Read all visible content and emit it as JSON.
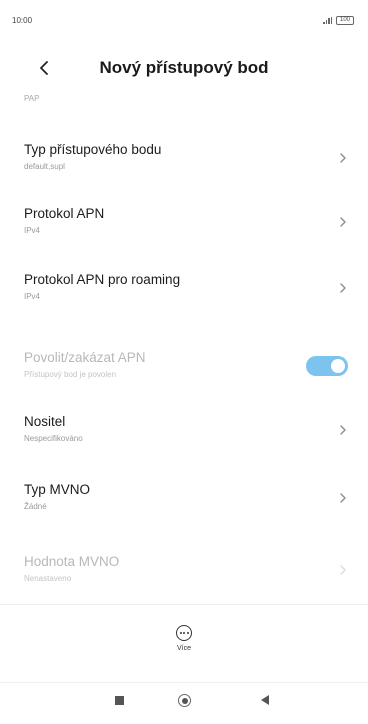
{
  "status_bar": {
    "time": "10:00",
    "battery": "100"
  },
  "header": {
    "title": "Nový přístupový bod"
  },
  "partial_item": {
    "value": "PAP"
  },
  "items": [
    {
      "title": "Typ přístupového bodu",
      "value": "default,supl",
      "control": "chevron",
      "enabled": true
    },
    {
      "title": "Protokol APN",
      "value": "IPv4",
      "control": "chevron",
      "enabled": true
    },
    {
      "title": "Protokol APN pro roaming",
      "value": "IPv4",
      "control": "chevron",
      "enabled": true
    },
    {
      "title": "Povolit/zakázat APN",
      "value": "Přístupový bod je povolen",
      "control": "toggle",
      "toggle_on": true,
      "enabled": false
    },
    {
      "title": "Nositel",
      "value": "Nespecifikováno",
      "control": "chevron",
      "enabled": true
    },
    {
      "title": "Typ MVNO",
      "value": "Žádné",
      "control": "chevron",
      "enabled": true
    },
    {
      "title": "Hodnota MVNO",
      "value": "Nenastaveno",
      "control": "chevron",
      "enabled": false
    }
  ],
  "more": {
    "label": "Více",
    "icon": "more-icon"
  },
  "colors": {
    "accent": "#7cc3ef",
    "text": "#1b1b1b",
    "secondary": "#9a9a9a"
  }
}
